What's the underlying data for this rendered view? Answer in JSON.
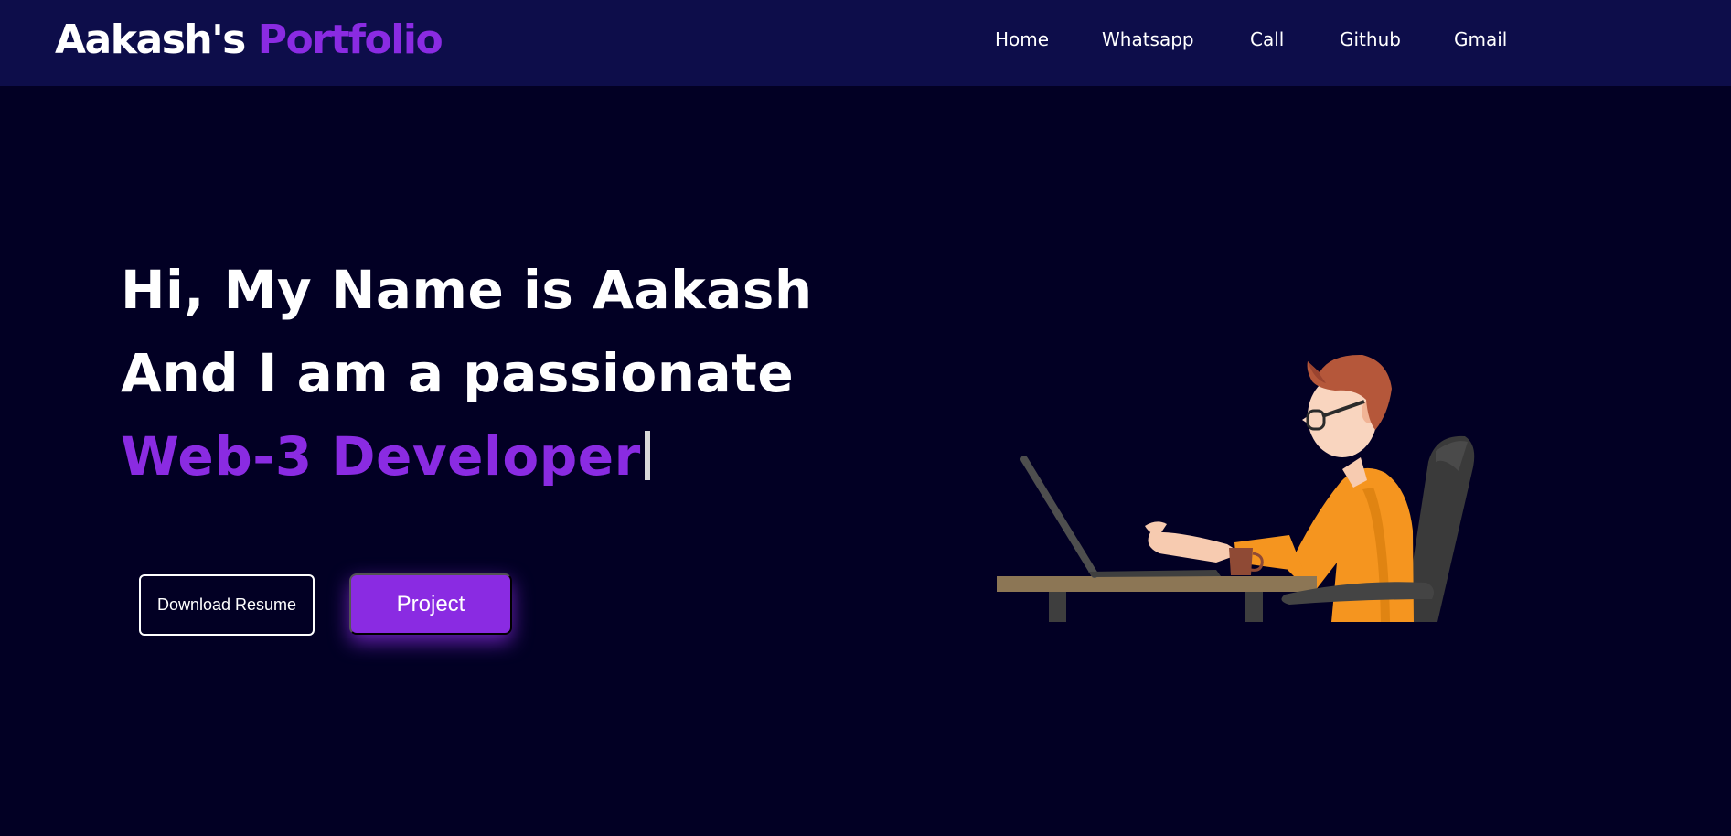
{
  "brand": {
    "name": "Aakash's",
    "accent_word": "Portfolio",
    "accent_color": "#8a2be2"
  },
  "nav": {
    "items": [
      {
        "label": "Home"
      },
      {
        "label": "Whatsapp"
      },
      {
        "label": "Call"
      },
      {
        "label": "Github"
      },
      {
        "label": "Gmail"
      }
    ]
  },
  "hero": {
    "line1": "Hi, My Name is Aakash",
    "line2": "And I am a passionate",
    "role": "Web-3 Developer"
  },
  "buttons": {
    "resume": "Download Resume",
    "project": "Project"
  },
  "illustration": {
    "icon": "developer-at-laptop-illustration"
  },
  "colors": {
    "background": "#020024",
    "navbar": "#0d0d4a",
    "accent": "#8a2be2"
  }
}
